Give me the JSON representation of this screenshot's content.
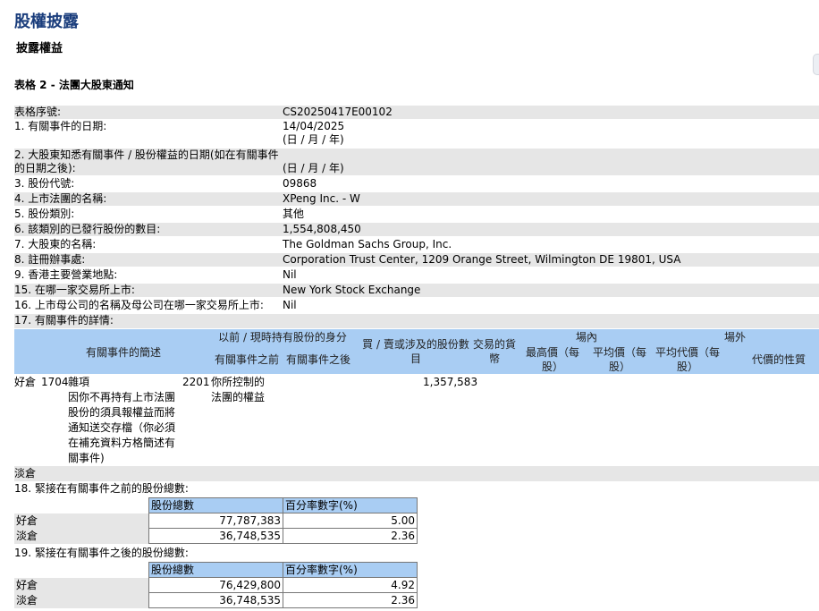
{
  "page": {
    "title": "股權披露",
    "subtitle": "披露權益",
    "form_heading": "表格 2 - 法團大股東通知"
  },
  "fields": [
    {
      "label": "表格序號:",
      "value": "CS20250417E00102"
    },
    {
      "label": "1. 有關事件的日期:",
      "value": "14/04/2025",
      "value2": "(日 / 月 / 年)"
    },
    {
      "label": "2. 大股東知悉有關事件 / 股份權益的日期(如在有關事件",
      "label2": "的日期之後):",
      "value": "(日 / 月 / 年)"
    },
    {
      "label": "3. 股份代號:",
      "value": "09868"
    },
    {
      "label": "4. 上市法團的名稱:",
      "value": "XPeng Inc. - W"
    },
    {
      "label": "5. 股份類別:",
      "value": "其他"
    },
    {
      "label": "6. 該類別的已發行股份的數目:",
      "value": "1,554,808,450"
    },
    {
      "label": "7. 大股東的名稱:",
      "value": "The Goldman Sachs Group, Inc."
    },
    {
      "label": "8. 註冊辦事處:",
      "value": "Corporation Trust Center, 1209 Orange Street, Wilmington DE 19801, USA"
    },
    {
      "label": "9. 香港主要營業地點:",
      "value": "Nil"
    },
    {
      "label": "15. 在哪一家交易所上市:",
      "value": "New York Stock Exchange"
    },
    {
      "label": "16. 上市母公司的名稱及母公司在哪一家交易所上市:",
      "value": "Nil"
    },
    {
      "label": "17. 有關事件的詳情:",
      "value": ""
    }
  ],
  "detail_table": {
    "headers": {
      "event_desc": "有關事件的簡述",
      "capacity_group": "以前 / 現時持有股份的身分",
      "before": "有關事件之前",
      "after": "有關事件之後",
      "num_shares": "買 / 賣或涉及的股份數目",
      "currency": "交易的貨幣",
      "on_exchange": "場內",
      "highest": "最高價（每股）",
      "average": "平均價（每股）",
      "off_exchange": "場外",
      "avg_consideration": "平均代價（每股）",
      "nature": "代價的性質"
    },
    "row": {
      "position": "好倉",
      "event_code": "1704",
      "event_title": "雜項",
      "event_desc_lines": [
        "因你不再持有上市法團",
        "股份的須具報權益而將",
        "通知送交存檔（你必須",
        "在補充資料方格簡述有",
        "關事件)"
      ],
      "capacity_code": "2201",
      "capacity_lines": [
        "你所控制的",
        "法團的權益"
      ],
      "num_shares": "1,357,583"
    },
    "short_label": "淡倉"
  },
  "section18": {
    "label": "18. 緊接在有關事件之前的股份總數:",
    "col_shares": "股份總數",
    "col_pct": "百分率數字(%)",
    "rows": [
      {
        "type": "好倉",
        "shares": "77,787,383",
        "pct": "5.00"
      },
      {
        "type": "淡倉",
        "shares": "36,748,535",
        "pct": "2.36"
      }
    ]
  },
  "section19": {
    "label": "19. 緊接在有關事件之後的股份總數:",
    "col_shares": "股份總數",
    "col_pct": "百分率數字(%)",
    "rows": [
      {
        "type": "好倉",
        "shares": "76,429,800",
        "pct": "4.92"
      },
      {
        "type": "淡倉",
        "shares": "36,748,535",
        "pct": "2.36"
      }
    ]
  },
  "colors": {
    "title": "#1a3d7c",
    "row_gray": "#e6e6e6",
    "header_blue": "#a9cdf3"
  }
}
